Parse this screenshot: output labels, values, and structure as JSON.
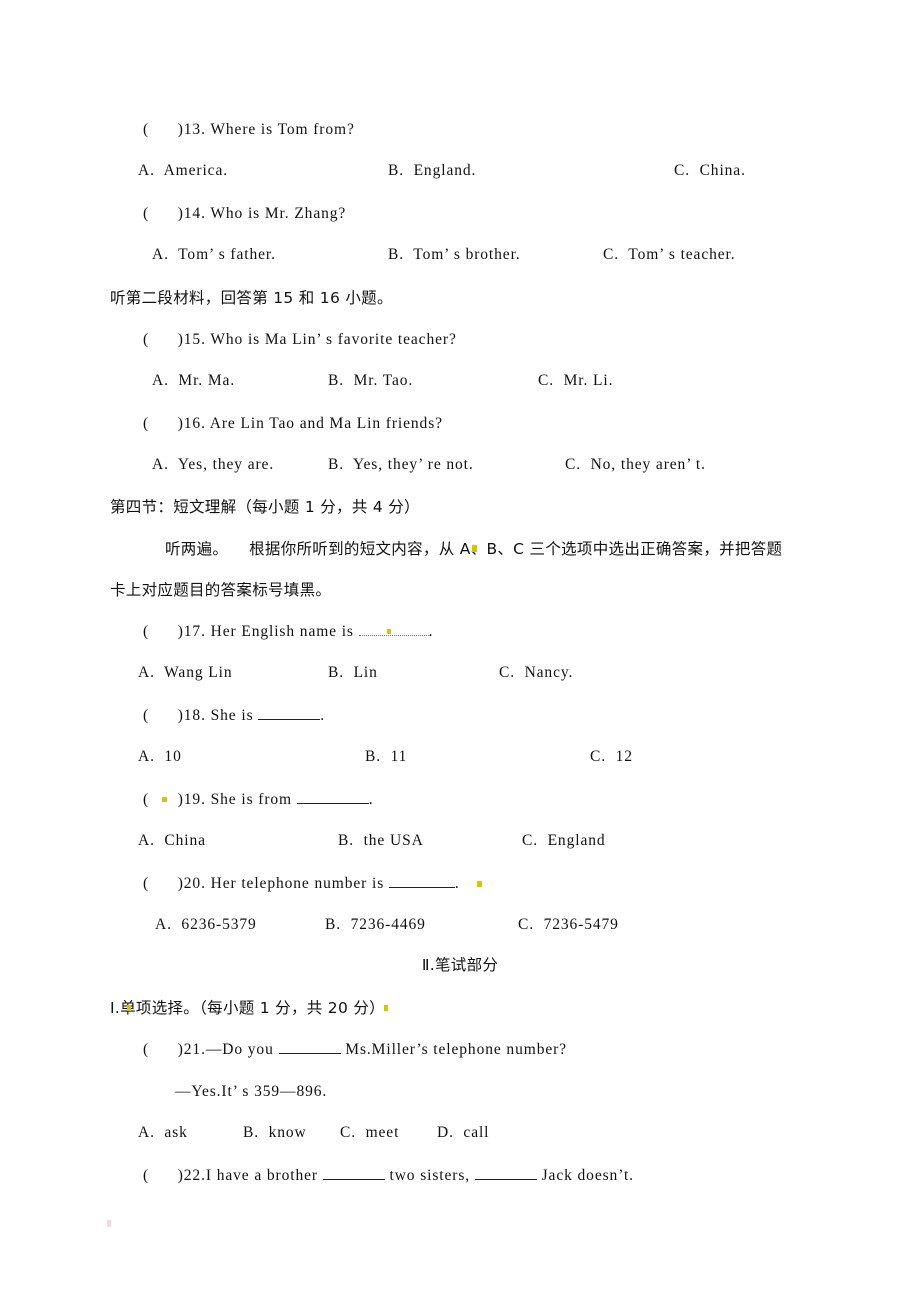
{
  "document": {
    "type": "exam-paper",
    "language": "zh-CN + en",
    "page_background": "#ffffff",
    "text_color": "#111111",
    "highlight_color": "#d8c500"
  },
  "listening_section": {
    "q13": {
      "paren": "(      )",
      "number": "13.",
      "stem": "Where is Tom from?",
      "options": {
        "a": "A.  America.",
        "b": "B.  England.",
        "c": "C.  China."
      }
    },
    "q14": {
      "paren": "(      )",
      "number": "14.",
      "stem": "Who is Mr. Zhang?",
      "options": {
        "a": "A.  Tom’ s father.",
        "b": "B.  Tom’ s brother.",
        "c": "C.  Tom’ s teacher."
      }
    },
    "material_2_instruction": "听第二段材料，回答第 15 和 16 小题。",
    "q15": {
      "paren": "(      )",
      "number": "15.",
      "stem": "Who is Ma Lin’ s favorite teacher?",
      "options": {
        "a": "A.  Mr. Ma.",
        "b": "B.  Mr. Tao.",
        "c": "C.  Mr. Li."
      }
    },
    "q16": {
      "paren": "(      )",
      "number": "16.",
      "stem": "Are Lin Tao and Ma Lin friends?",
      "options": {
        "a": "A.  Yes, they are.",
        "b": "B.  Yes, they’ re not.",
        "c": "C.  No, they aren’ t."
      }
    }
  },
  "section_four": {
    "heading": "第四节：短文理解（每小题 1 分，共 4 分）",
    "instruction_line_1": "听两遍。    根据你所听到的短文内容，从 A、B、C 三个选项中选出正确答案，并把答题",
    "instruction_line_2": "卡上对应题目的答案标号填黑。",
    "q17": {
      "paren": "(      )",
      "number": "17.",
      "stem_before": "Her English name is ",
      "stem_after": ".",
      "options": {
        "a": "A.  Wang Lin",
        "b": "B.  Lin",
        "c": "C.  Nancy."
      }
    },
    "q18": {
      "paren": "(      )",
      "number": "18.",
      "stem_before": "She is ",
      "stem_after": ".",
      "options": {
        "a": "A.  10",
        "b": "B.  11",
        "c": "C.  12"
      }
    },
    "q19": {
      "paren": "(      )",
      "number": "19.",
      "stem_before": "She is from ",
      "stem_after": ".",
      "options": {
        "a": "A.  China",
        "b": "B.  the USA",
        "c": "C.  England"
      }
    },
    "q20": {
      "paren": "(      )",
      "number": "20.",
      "stem_before": "Her telephone number is ",
      "stem_after": ".",
      "options": {
        "a": "A.  6236-5379",
        "b": "B.  7236-4469",
        "c": "C.  7236-5479"
      }
    }
  },
  "written_part": {
    "title": "Ⅱ.笔试部分",
    "section_1_heading": "I.单项选择。（每小题 1 分，共 20 分）",
    "q21": {
      "paren": "(      )",
      "number": "21.",
      "stem_before": "—Do you ",
      "stem_after": " Ms.Miller’s telephone number?",
      "answer_line": "—Yes.It’ s 359—896.",
      "options": {
        "a": "A.  ask",
        "b": "B.  know",
        "c": "C.  meet",
        "d": "D.  call"
      }
    },
    "q22": {
      "paren": "(      )",
      "number": "22.",
      "stem_part_1": "I have a brother ",
      "stem_part_2": " two sisters, ",
      "stem_part_3": " Jack doesn’t."
    }
  }
}
